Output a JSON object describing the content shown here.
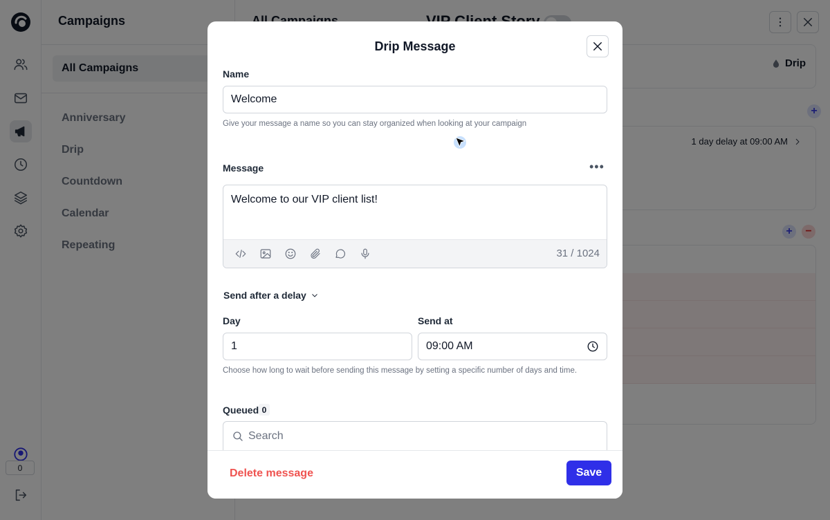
{
  "app": {
    "rail_badge": "0",
    "brand_color": "#2f2fe8",
    "danger_color": "#ef5350"
  },
  "campaigns": {
    "title": "Campaigns",
    "selected": "All Campaigns",
    "items": [
      "Anniversary",
      "Drip",
      "Countdown",
      "Calendar",
      "Repeating"
    ]
  },
  "list": {
    "title": "All Campaigns"
  },
  "panel": {
    "title": "VIP Client Story",
    "type_label": "Drip",
    "delay_text": "1 day delay at 09:00 AM"
  },
  "modal": {
    "title": "Drip Message",
    "name_label": "Name",
    "name_value": "Welcome",
    "name_help": "Give your message a name so you can stay organized when looking at your campaign",
    "message_label": "Message",
    "message_value": "Welcome to our VIP client list!",
    "char_count": "31 / 1024",
    "delay_mode": "Send after a delay",
    "day_label": "Day",
    "day_value": "1",
    "send_at_label": "Send at",
    "send_at_value": "09:00 AM",
    "timing_help": "Choose how long to wait before sending this message by setting a specific number of days and time.",
    "queued_label": "Queued",
    "queued_count": "0",
    "search_placeholder": "Search",
    "delete_label": "Delete message",
    "save_label": "Save",
    "toolbar_icons": [
      "code-icon",
      "image-icon",
      "emoji-icon",
      "attachment-icon",
      "chat-bubble-icon",
      "microphone-icon"
    ]
  }
}
